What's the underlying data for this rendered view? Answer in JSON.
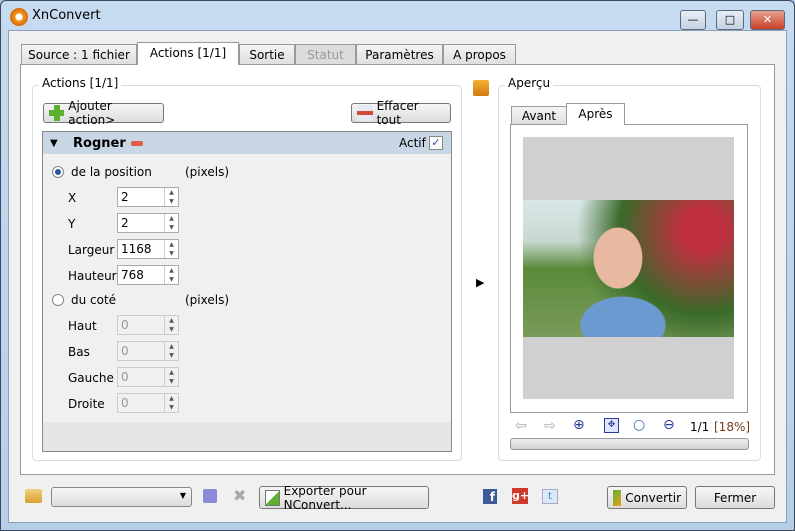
{
  "window": {
    "title": "XnConvert",
    "minimize": "—",
    "maximize": "□",
    "close": "✕"
  },
  "tabs": [
    {
      "label": "Source : 1 fichier"
    },
    {
      "label": "Actions [1/1]"
    },
    {
      "label": "Sortie"
    },
    {
      "label": "Statut"
    },
    {
      "label": "Paramètres"
    },
    {
      "label": "A propos"
    }
  ],
  "actions": {
    "group_label": "Actions [1/1]",
    "add_button": "Ajouter action>",
    "clear_button": "Effacer tout",
    "item": {
      "name": "Rogner",
      "active_label": "Actif",
      "active": true,
      "position_mode": {
        "label": "de la position",
        "unit": "(pixels)",
        "selected": true,
        "fields": [
          {
            "label": "X",
            "value": "2"
          },
          {
            "label": "Y",
            "value": "2"
          },
          {
            "label": "Largeur",
            "value": "1168"
          },
          {
            "label": "Hauteur",
            "value": "768"
          }
        ]
      },
      "side_mode": {
        "label": "du coté",
        "unit": "(pixels)",
        "selected": false,
        "fields": [
          {
            "label": "Haut",
            "value": "0"
          },
          {
            "label": "Bas",
            "value": "0"
          },
          {
            "label": "Gauche",
            "value": "0"
          },
          {
            "label": "Droite",
            "value": "0"
          }
        ]
      }
    }
  },
  "preview": {
    "group_label": "Aperçu",
    "tabs": [
      {
        "label": "Avant"
      },
      {
        "label": "Après"
      }
    ],
    "page_info": "1/1",
    "zoom": "[18%]"
  },
  "bottom": {
    "export_button": "Exporter pour NConvert...",
    "convert_button": "Convertir",
    "close_button": "Fermer"
  }
}
